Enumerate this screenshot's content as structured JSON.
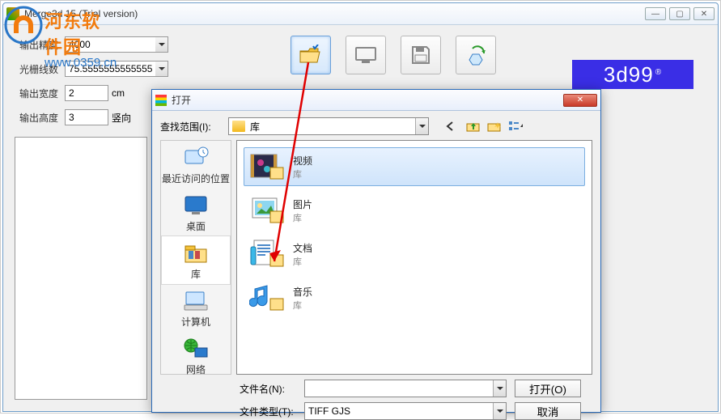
{
  "main": {
    "title": "Merge3d 15  (Trial version)",
    "fields": {
      "precision_label": "输出精度",
      "precision_value": "4000",
      "lines_label": "光栅线数",
      "lines_value": "75.5555555555555",
      "width_label": "输出宽度",
      "width_value": "2",
      "width_unit": "cm",
      "height_label": "输出高度",
      "height_value": "3",
      "orient_label": "竖向"
    },
    "brand": "3d99",
    "brand_mark": "®"
  },
  "dialog": {
    "title": "打开",
    "lookin_label": "查找范围(I):",
    "lookin_value": "库",
    "places": [
      {
        "label": "最近访问的位置"
      },
      {
        "label": "桌面"
      },
      {
        "label": "库"
      },
      {
        "label": "计算机"
      },
      {
        "label": "网络"
      }
    ],
    "items": [
      {
        "name": "视频",
        "sub": "库"
      },
      {
        "name": "图片",
        "sub": "库"
      },
      {
        "name": "文档",
        "sub": "库"
      },
      {
        "name": "音乐",
        "sub": "库"
      }
    ],
    "filename_label": "文件名(N):",
    "filename_value": "",
    "filetype_label": "文件类型(T):",
    "filetype_value": "TIFF GJS",
    "open_btn": "打开(O)",
    "cancel_btn": "取消"
  },
  "watermark": {
    "cn": "河东软件园",
    "url": "www.0359.cn"
  }
}
